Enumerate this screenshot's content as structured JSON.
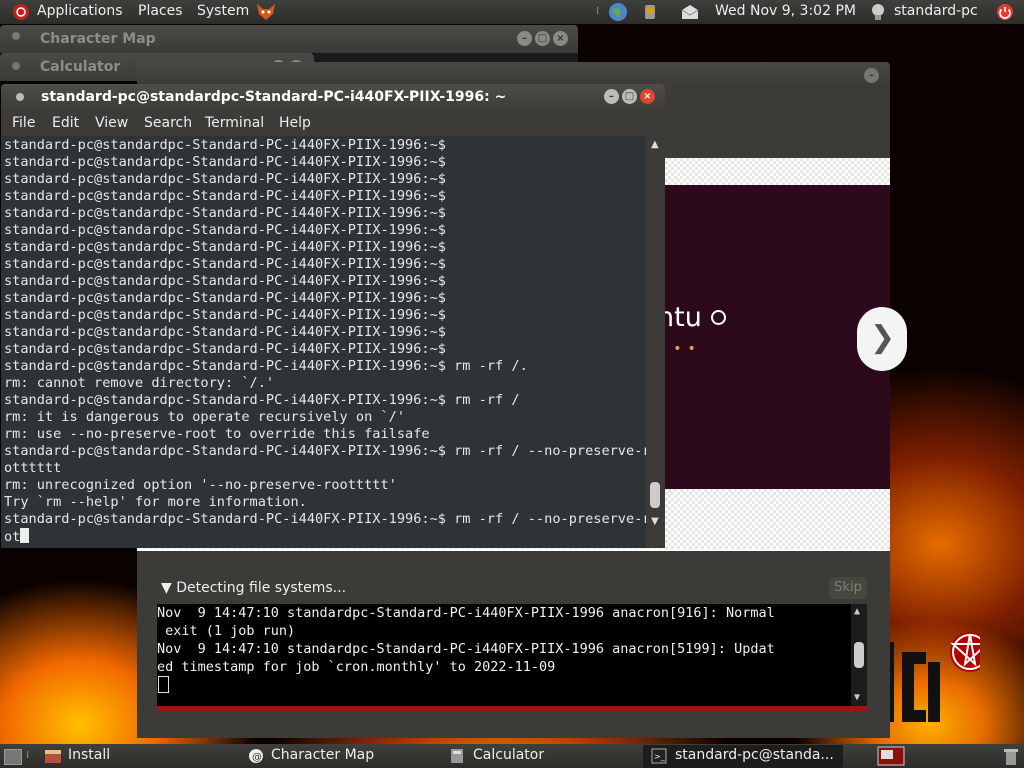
{
  "top_panel": {
    "menus": [
      "Applications",
      "Places",
      "System"
    ],
    "datetime": "Wed Nov 9,  3:02 PM",
    "user": "standard-pc"
  },
  "windows": {
    "charmap_title": "Character Map",
    "calculator_title": "Calculator",
    "terminal": {
      "title": "standard-pc@standardpc-Standard-PC-i440FX-PIIX-1996: ~",
      "menu": [
        "File",
        "Edit",
        "View",
        "Search",
        "Terminal",
        "Help"
      ],
      "lines": [
        "standard-pc@standardpc-Standard-PC-i440FX-PIIX-1996:~$",
        "standard-pc@standardpc-Standard-PC-i440FX-PIIX-1996:~$",
        "standard-pc@standardpc-Standard-PC-i440FX-PIIX-1996:~$",
        "standard-pc@standardpc-Standard-PC-i440FX-PIIX-1996:~$",
        "standard-pc@standardpc-Standard-PC-i440FX-PIIX-1996:~$",
        "standard-pc@standardpc-Standard-PC-i440FX-PIIX-1996:~$",
        "standard-pc@standardpc-Standard-PC-i440FX-PIIX-1996:~$",
        "standard-pc@standardpc-Standard-PC-i440FX-PIIX-1996:~$",
        "standard-pc@standardpc-Standard-PC-i440FX-PIIX-1996:~$",
        "standard-pc@standardpc-Standard-PC-i440FX-PIIX-1996:~$",
        "standard-pc@standardpc-Standard-PC-i440FX-PIIX-1996:~$",
        "standard-pc@standardpc-Standard-PC-i440FX-PIIX-1996:~$",
        "standard-pc@standardpc-Standard-PC-i440FX-PIIX-1996:~$",
        "standard-pc@standardpc-Standard-PC-i440FX-PIIX-1996:~$ rm -rf /.",
        "rm: cannot remove directory: `/.'",
        "standard-pc@standardpc-Standard-PC-i440FX-PIIX-1996:~$ rm -rf /",
        "rm: it is dangerous to operate recursively on `/'",
        "rm: use --no-preserve-root to override this failsafe",
        "standard-pc@standardpc-Standard-PC-i440FX-PIIX-1996:~$ rm -rf / --no-preserve-ro",
        "otttttt",
        "rm: unrecognized option '--no-preserve-roottttt'",
        "Try `rm --help' for more information.",
        "standard-pc@standardpc-Standard-PC-i440FX-PIIX-1996:~$ rm -rf / --no-preserve-ro",
        "ot"
      ]
    },
    "installer": {
      "slide_brand": "ntu",
      "next_arrow": "❯",
      "detect_label": "▼ Detecting file systems...",
      "skip_label": "Skip",
      "log_lines": [
        "Nov  9 14:47:10 standardpc-Standard-PC-i440FX-PIIX-1996 anacron[916]: Normal",
        " exit (1 job run)",
        "Nov  9 14:47:10 standardpc-Standard-PC-i440FX-PIIX-1996 anacron[5199]: Updat",
        "ed timestamp for job `cron.monthly' to 2022-11-09"
      ]
    }
  },
  "taskbar": {
    "items": [
      "Install",
      "Character Map",
      "Calculator",
      "standard-pc@standa..."
    ]
  },
  "colors": {
    "panel": "#3c3b37",
    "terminal_bg": "#2e3436",
    "slide_bg": "#2c0a1c",
    "progress": "#9c1414"
  }
}
